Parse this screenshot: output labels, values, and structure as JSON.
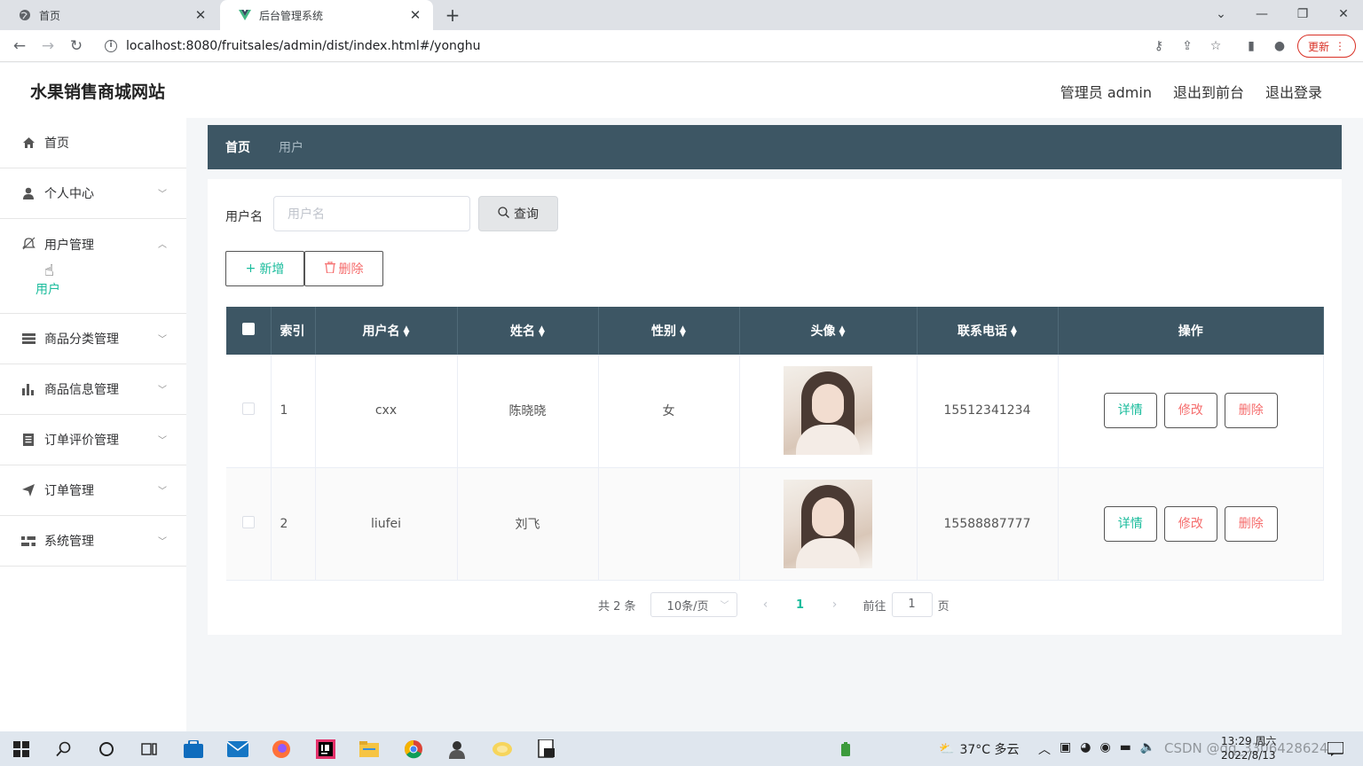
{
  "browser": {
    "tabs": [
      {
        "title": "首页",
        "icon": "globe-icon"
      },
      {
        "title": "后台管理系统",
        "icon": "vue-logo-icon"
      }
    ],
    "url": "localhost:8080/fruitsales/admin/dist/index.html#/yonghu",
    "update_label": "更新"
  },
  "header": {
    "site_title": "水果销售商城网站",
    "admin_label": "管理员 admin",
    "back_to_front": "退出到前台",
    "logout": "退出登录"
  },
  "sidebar": {
    "items": [
      {
        "label": "首页",
        "icon": "home-icon"
      },
      {
        "label": "个人中心",
        "icon": "user-icon"
      },
      {
        "label": "用户管理",
        "icon": "bell-icon",
        "sub": "用户"
      },
      {
        "label": "商品分类管理",
        "icon": "list-icon"
      },
      {
        "label": "商品信息管理",
        "icon": "bar-chart-icon"
      },
      {
        "label": "订单评价管理",
        "icon": "document-icon"
      },
      {
        "label": "订单管理",
        "icon": "send-icon"
      },
      {
        "label": "系统管理",
        "icon": "settings-icon"
      }
    ]
  },
  "breadcrumb": {
    "home": "首页",
    "current": "用户"
  },
  "search": {
    "label": "用户名",
    "placeholder": "用户名",
    "button": "查询"
  },
  "actions": {
    "add": "新增",
    "delete": "删除"
  },
  "table": {
    "headers": {
      "index": "索引",
      "username": "用户名",
      "name": "姓名",
      "gender": "性别",
      "avatar": "头像",
      "phone": "联系电话",
      "ops": "操作"
    },
    "rows": [
      {
        "index": "1",
        "username": "cxx",
        "name": "陈晓晓",
        "gender": "女",
        "phone": "15512341234"
      },
      {
        "index": "2",
        "username": "liufei",
        "name": "刘飞",
        "gender": "",
        "phone": "15588887777"
      }
    ],
    "op_labels": {
      "detail": "详情",
      "edit": "修改",
      "remove": "删除"
    }
  },
  "pager": {
    "total": "共 2 条",
    "page_size": "10条/页",
    "current_page": "1",
    "goto_label": "前往",
    "goto_value": "1",
    "page_unit": "页"
  },
  "taskbar": {
    "weather": "37°C 多云",
    "time": "13:29 周六",
    "date": "2022/8/13",
    "watermark": "CSDN @qq_3306428624"
  }
}
